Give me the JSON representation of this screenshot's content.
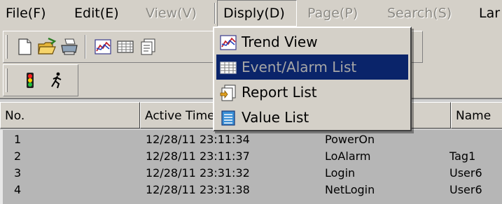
{
  "menubar": {
    "items": [
      {
        "label": "File(F)",
        "state": "enabled"
      },
      {
        "label": "Edit(E)",
        "state": "enabled"
      },
      {
        "label": "View(V)",
        "state": "disabled"
      },
      {
        "label": "Disply(D)",
        "state": "active"
      },
      {
        "label": "Page(P)",
        "state": "disabled"
      },
      {
        "label": "Search(S)",
        "state": "disabled"
      },
      {
        "label": "Lar",
        "state": "enabled"
      }
    ]
  },
  "toolbar1": {
    "buttons": [
      {
        "icon": "new-document-icon"
      },
      {
        "icon": "open-folder-icon"
      },
      {
        "icon": "print-icon"
      },
      {
        "icon": "trend-chart-icon"
      },
      {
        "icon": "table-grid-icon"
      },
      {
        "icon": "report-icon"
      }
    ]
  },
  "toolbar2": {
    "buttons": [
      {
        "icon": "traffic-light-icon"
      },
      {
        "icon": "running-man-icon"
      }
    ]
  },
  "display_menu": {
    "items": [
      {
        "label": "Trend View",
        "icon": "trend-chart-icon",
        "highlighted": false
      },
      {
        "label": "Event/Alarm List",
        "icon": "table-grid-icon",
        "highlighted": true
      },
      {
        "label": "Report List",
        "icon": "report-icon",
        "highlighted": false
      },
      {
        "label": "Value List",
        "icon": "value-list-icon",
        "highlighted": false
      }
    ]
  },
  "list": {
    "columns": [
      "No.",
      "Active Time",
      "",
      "Name"
    ],
    "rows": [
      {
        "no": "1",
        "time": "12/28/11 23:11:34",
        "event": "PowerOn",
        "name": ""
      },
      {
        "no": "2",
        "time": "12/28/11 23:11:37",
        "event": "LoAlarm",
        "name": "Tag1"
      },
      {
        "no": "3",
        "time": "12/28/11 23:31:32",
        "event": "Login",
        "name": "User6"
      },
      {
        "no": "4",
        "time": "12/28/11 23:31:38",
        "event": "NetLogin",
        "name": "User6"
      }
    ]
  },
  "colors": {
    "chrome": "#d4d0c8",
    "highlight": "#0a246a",
    "list_body": "#b6b6b6"
  }
}
